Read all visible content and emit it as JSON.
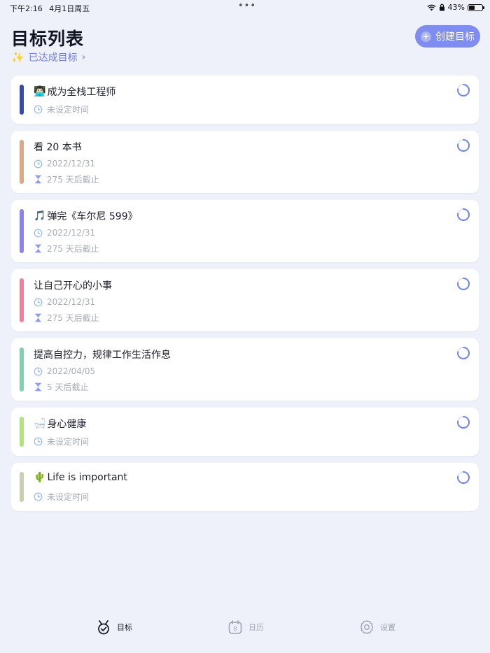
{
  "status_bar": {
    "time": "下午2:16",
    "date": "4月1日周五",
    "dots": "•••",
    "battery_text": "43%",
    "battery_level": 0.43
  },
  "header": {
    "title": "目标列表",
    "achieved_label": "已达成目标",
    "achieved_chevron": "›",
    "achieved_icon": "✨",
    "create_label": "创建目标",
    "accent_color": "#7f8cf0"
  },
  "goals": [
    {
      "emoji": "👨🏻‍💻",
      "title": "成为全栈工程师",
      "date": "未设定时间",
      "deadline": null,
      "color": "#3b4aa8"
    },
    {
      "emoji": "",
      "title": "看 20 本书",
      "date": "2022/12/31",
      "deadline": "275 天后截止",
      "color": "#d8ab86"
    },
    {
      "emoji": "🎵",
      "title": "弹完《车尔尼 599》",
      "date": "2022/12/31",
      "deadline": "275 天后截止",
      "color": "#8a84ea"
    },
    {
      "emoji": "",
      "title": "让自己开心的小事",
      "date": "2022/12/31",
      "deadline": "275 天后截止",
      "color": "#ea829c"
    },
    {
      "emoji": "",
      "title": "提高自控力，规律工作生活作息",
      "date": "2022/04/05",
      "deadline": "5 天后截止",
      "color": "#82d1ae"
    },
    {
      "emoji": "🛁",
      "title": "身心健康",
      "date": "未设定时间",
      "deadline": null,
      "color": "#b3e27c"
    },
    {
      "emoji": "🌵",
      "title": "Life is important",
      "date": "未设定时间",
      "deadline": null,
      "color": "#c8d0b3"
    }
  ],
  "tabs": [
    {
      "label": "目标",
      "icon": "medal-check-icon",
      "active": true
    },
    {
      "label": "日历",
      "icon": "calendar-icon",
      "active": false,
      "badge": "8"
    },
    {
      "label": "设置",
      "icon": "gear-icon",
      "active": false
    }
  ]
}
